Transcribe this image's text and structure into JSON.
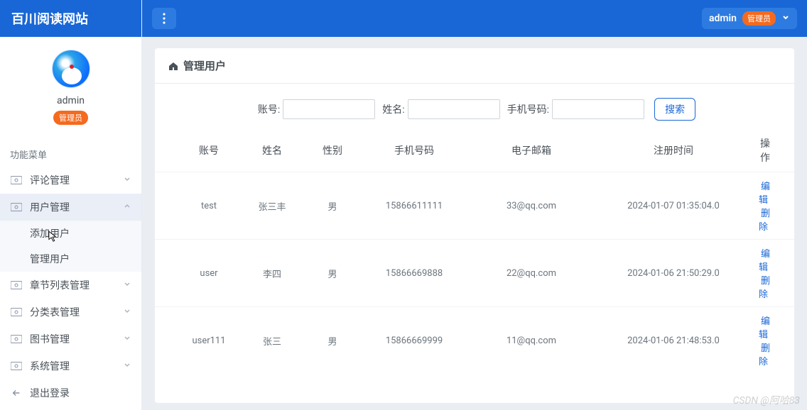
{
  "brand": "百川阅读网站",
  "profile": {
    "name": "admin",
    "role": "管理员"
  },
  "menu_title": "功能菜单",
  "sidebar": {
    "items": [
      {
        "label": "评论管理",
        "icon": "money",
        "expanded": false
      },
      {
        "label": "用户管理",
        "icon": "money",
        "expanded": true,
        "children": [
          {
            "label": "添加用户"
          },
          {
            "label": "管理用户"
          }
        ]
      },
      {
        "label": "章节列表管理",
        "icon": "money",
        "expanded": false
      },
      {
        "label": "分类表管理",
        "icon": "money",
        "expanded": false
      },
      {
        "label": "图书管理",
        "icon": "money",
        "expanded": false
      },
      {
        "label": "系统管理",
        "icon": "money",
        "expanded": false
      },
      {
        "label": "退出登录",
        "icon": "arrow-left",
        "expanded": null
      }
    ]
  },
  "topbar": {
    "user": "admin",
    "role": "管理员"
  },
  "page": {
    "title": "管理用户",
    "search": {
      "account_label": "账号:",
      "name_label": "姓名:",
      "phone_label": "手机号码:",
      "account_value": "",
      "name_value": "",
      "phone_value": "",
      "button": "搜索"
    },
    "columns": {
      "account": "账号",
      "name": "姓名",
      "gender": "性别",
      "phone": "手机号码",
      "email": "电子邮箱",
      "time": "注册时间",
      "actions": "操作"
    },
    "rows": [
      {
        "account": "test",
        "name": "张三丰",
        "gender": "男",
        "phone": "15866611111",
        "email": "33@qq.com",
        "time": "2024-01-07 01:35:04.0"
      },
      {
        "account": "user",
        "name": "李四",
        "gender": "男",
        "phone": "15866669888",
        "email": "22@qq.com",
        "time": "2024-01-06 21:50:29.0"
      },
      {
        "account": "user111",
        "name": "张三",
        "gender": "男",
        "phone": "15866669999",
        "email": "11@qq.com",
        "time": "2024-01-06 21:48:53.0"
      }
    ],
    "action_edit": "编辑",
    "action_delete": "删除"
  },
  "watermark": "CSDN @阿哈83"
}
